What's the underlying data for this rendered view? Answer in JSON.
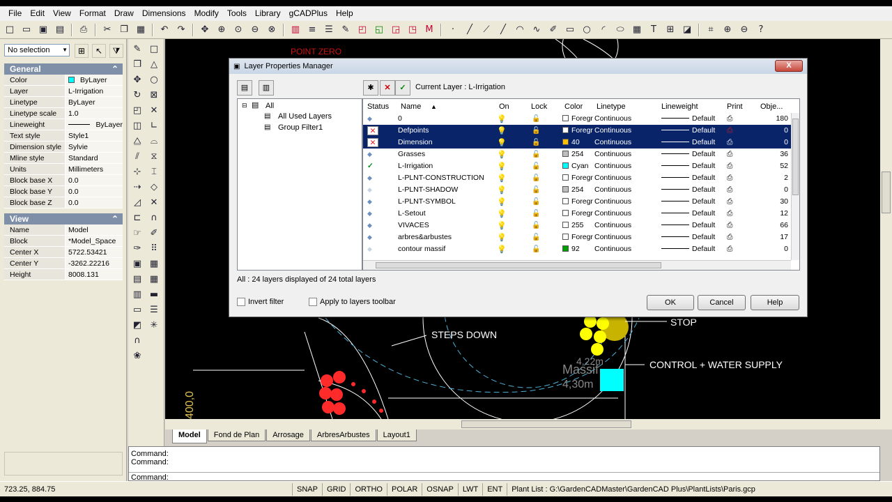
{
  "menu": [
    "File",
    "Edit",
    "View",
    "Format",
    "Draw",
    "Dimensions",
    "Modify",
    "Tools",
    "Library",
    "gCADPlus",
    "Help"
  ],
  "selection": "No selection",
  "general": {
    "title": "General",
    "rows": [
      {
        "k": "Color",
        "v": "ByLayer"
      },
      {
        "k": "Layer",
        "v": "L-Irrigation"
      },
      {
        "k": "Linetype",
        "v": "ByLayer"
      },
      {
        "k": "Linetype scale",
        "v": "1.0"
      },
      {
        "k": "Lineweight",
        "v": "ByLayer"
      },
      {
        "k": "Text style",
        "v": "Style1"
      },
      {
        "k": "Dimension style",
        "v": "Sylvie"
      },
      {
        "k": "Mline style",
        "v": "Standard"
      },
      {
        "k": "Units",
        "v": "Millimeters"
      },
      {
        "k": "Block base X",
        "v": "0.0"
      },
      {
        "k": "Block base Y",
        "v": "0.0"
      },
      {
        "k": "Block base Z",
        "v": "0.0"
      }
    ]
  },
  "view": {
    "title": "View",
    "rows": [
      {
        "k": "Name",
        "v": "Model"
      },
      {
        "k": "Block",
        "v": "*Model_Space"
      },
      {
        "k": "Center X",
        "v": "5722.53421"
      },
      {
        "k": "Center Y",
        "v": "-3262.22216"
      },
      {
        "k": "Height",
        "v": "8008.131"
      }
    ]
  },
  "canvas_text": {
    "steps": "STEPS DOWN",
    "control": "CONTROL + WATER SUPPLY",
    "stop": "STOP",
    "point": "POINT ZERO",
    "massif": "Massif",
    "dim1": "4,22m",
    "dim2": "4,30m",
    "dim3": "400,0"
  },
  "dialog": {
    "title": "Layer Properties Manager",
    "close": "X",
    "current_layer": "Current Layer : L-Irrigation",
    "tree": {
      "root": "All",
      "children": [
        "All Used Layers",
        "Group Filter1"
      ]
    },
    "headers": {
      "status": "Status",
      "name": "Name",
      "on": "On",
      "lock": "Lock",
      "color": "Color",
      "linetype": "Linetype",
      "lineweight": "Lineweight",
      "print": "Print",
      "objects": "Obje..."
    },
    "rows": [
      {
        "status": "arrow",
        "name": "0",
        "color": "Foregr",
        "swatch": "#ffffff",
        "linetype": "Continuous",
        "lineweight": "Default",
        "objects": "180",
        "selected": false
      },
      {
        "status": "x",
        "name": "Defpoints",
        "color": "Foregr",
        "swatch": "#ffffff",
        "linetype": "Continuous",
        "lineweight": "Default",
        "objects": "0",
        "selected": true
      },
      {
        "status": "x",
        "name": "Dimension",
        "color": "40",
        "swatch": "#ffbf00",
        "linetype": "Continuous",
        "lineweight": "Default",
        "objects": "0",
        "selected": true
      },
      {
        "status": "arrow",
        "name": "Grasses",
        "color": "254",
        "swatch": "#bebebe",
        "linetype": "Continuous",
        "lineweight": "Default",
        "objects": "36",
        "selected": false
      },
      {
        "status": "check",
        "name": "L-Irrigation",
        "color": "Cyan",
        "swatch": "#00ffff",
        "linetype": "Continuous",
        "lineweight": "Default",
        "objects": "52",
        "selected": false
      },
      {
        "status": "arrow",
        "name": "L-PLNT-CONSTRUCTION",
        "color": "Foregr",
        "swatch": "#ffffff",
        "linetype": "Continuous",
        "lineweight": "Default",
        "objects": "2",
        "selected": false
      },
      {
        "status": "arrow-faint",
        "name": "L-PLNT-SHADOW",
        "color": "254",
        "swatch": "#bebebe",
        "linetype": "Continuous",
        "lineweight": "Default",
        "objects": "0",
        "selected": false
      },
      {
        "status": "arrow",
        "name": "L-PLNT-SYMBOL",
        "color": "Foregr",
        "swatch": "#ffffff",
        "linetype": "Continuous",
        "lineweight": "Default",
        "objects": "30",
        "selected": false
      },
      {
        "status": "arrow",
        "name": "L-Setout",
        "color": "Foregr",
        "swatch": "#ffffff",
        "linetype": "Continuous",
        "lineweight": "Default",
        "objects": "12",
        "selected": false
      },
      {
        "status": "arrow",
        "name": "VIVACES",
        "color": "255",
        "swatch": "#ffffff",
        "linetype": "Continuous",
        "lineweight": "Default",
        "objects": "66",
        "selected": false
      },
      {
        "status": "arrow",
        "name": "arbres&arbustes",
        "color": "Foregr",
        "swatch": "#ffffff",
        "linetype": "Continuous",
        "lineweight": "Default",
        "objects": "17",
        "selected": false
      },
      {
        "status": "arrow-faint",
        "name": "contour massif",
        "color": "92",
        "swatch": "#00a000",
        "linetype": "Continuous",
        "lineweight": "Default",
        "objects": "0",
        "selected": false
      }
    ],
    "summary": "All : 24 layers displayed of 24 total layers",
    "invert_filter": "Invert filter",
    "apply_toolbar": "Apply to layers toolbar",
    "ok": "OK",
    "cancel": "Cancel",
    "help": "Help"
  },
  "layout_tabs": [
    "Model",
    "Fond de Plan",
    "Arrosage",
    "ArbresArbustes",
    "Layout1"
  ],
  "command_lines": [
    "Command:",
    "Command:",
    "Command:"
  ],
  "status": {
    "coords": "723.25,  884.75",
    "toggles": [
      "SNAP",
      "GRID",
      "ORTHO",
      "POLAR",
      "OSNAP",
      "LWT",
      "ENT"
    ],
    "plant_list": "Plant List : G:\\GardenCADMaster\\GardenCAD Plus\\PlantLists\\Paris.gcp"
  }
}
